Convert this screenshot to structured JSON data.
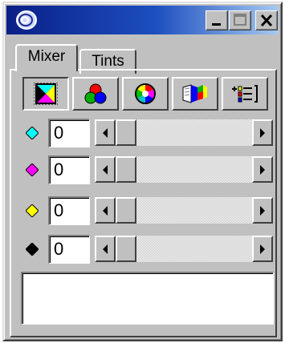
{
  "window": {
    "icon": "app-swirl-icon",
    "controls": [
      "minimize-icon",
      "maximize-icon",
      "close-icon"
    ]
  },
  "tabs": [
    {
      "label": "Mixer",
      "active": true
    },
    {
      "label": "Tints",
      "active": false
    }
  ],
  "toolbar": [
    {
      "icon": "cmyk-mode-icon",
      "pressed": true
    },
    {
      "icon": "rgb-mode-icon",
      "pressed": false
    },
    {
      "icon": "hsb-wheel-icon",
      "pressed": false
    },
    {
      "icon": "color-book-icon",
      "pressed": false
    },
    {
      "icon": "palette-options-icon",
      "pressed": false
    }
  ],
  "channels": [
    {
      "name": "cyan",
      "color": "#00ffff",
      "value": "0"
    },
    {
      "name": "magenta",
      "color": "#ff00ff",
      "value": "0"
    },
    {
      "name": "yellow",
      "color": "#ffff00",
      "value": "0"
    },
    {
      "name": "black",
      "color": "#000000",
      "value": "0"
    }
  ],
  "colors": {
    "face": "#c0c0c0",
    "title_start": "#0a1f86",
    "title_end": "#a6caf0"
  }
}
